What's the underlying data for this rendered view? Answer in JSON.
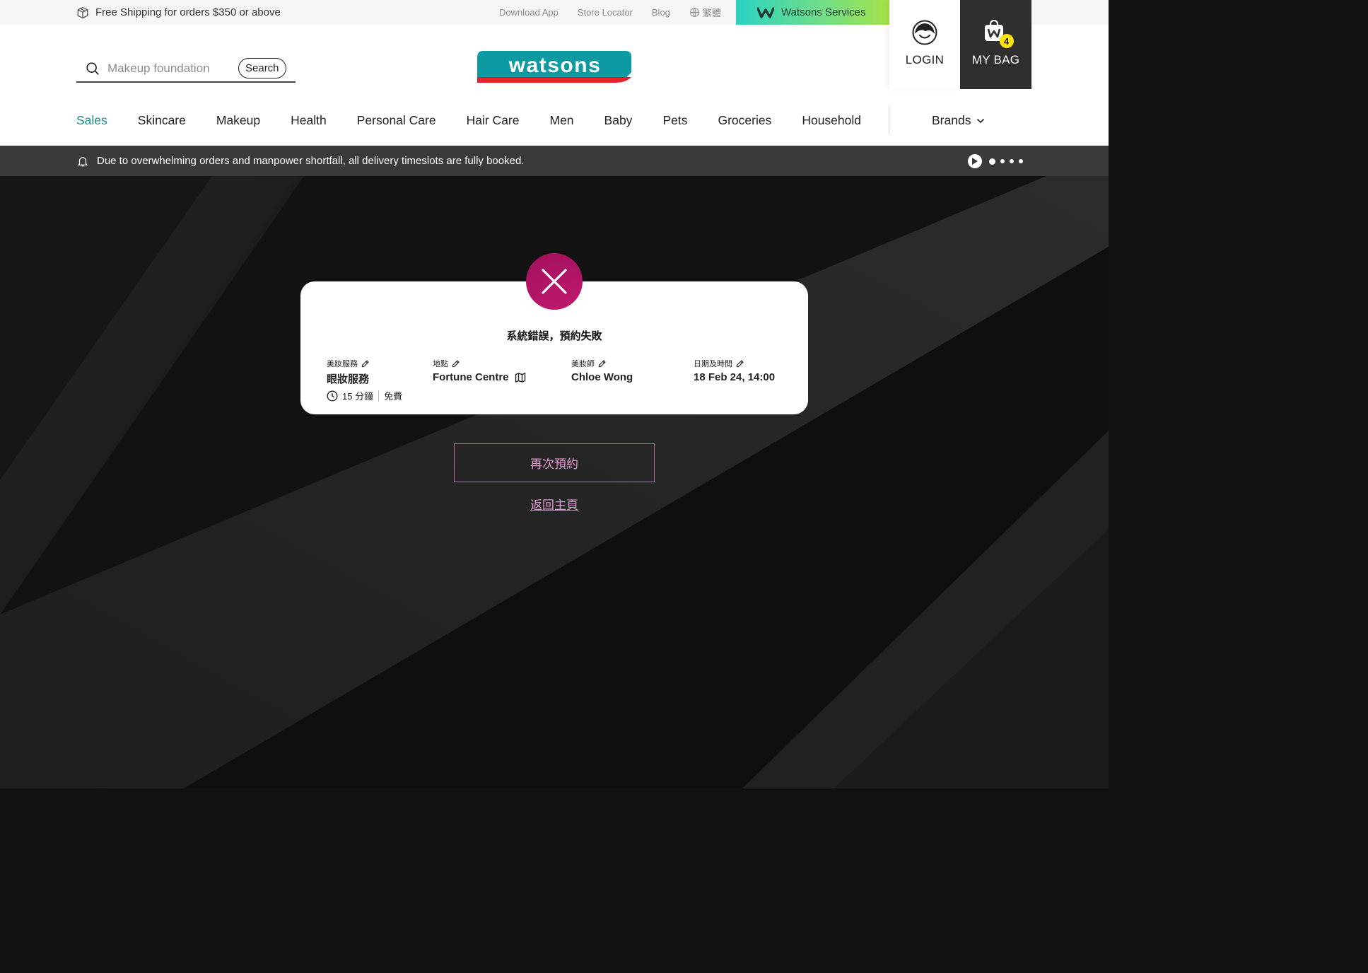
{
  "topbar": {
    "shipping_text": "Free Shipping for orders $350 or above",
    "links": [
      "Download App",
      "Store Locator",
      "Blog"
    ],
    "language": "繁體",
    "services_label": "Watsons Services"
  },
  "header": {
    "search": {
      "placeholder": "Makeup foundation",
      "button_label": "Search"
    },
    "logo_text": "watsons",
    "login_label": "LOGIN",
    "bag_label": "MY BAG",
    "bag_count": "4"
  },
  "nav": {
    "items": [
      "Sales",
      "Skincare",
      "Makeup",
      "Health",
      "Personal Care",
      "Hair Care",
      "Men",
      "Baby",
      "Pets",
      "Groceries",
      "Household"
    ],
    "active": "Sales",
    "brands_label": "Brands"
  },
  "announcement": {
    "text": "Due to overwhelming orders and manpower shortfall, all delivery timeslots are fully booked.",
    "slide_count": 4,
    "active_slide": 1
  },
  "booking": {
    "title": "系統錯誤，預約失敗",
    "service": {
      "label": "美妝服務",
      "value": "眼妝服務",
      "duration": "15 分鐘",
      "price": "免費"
    },
    "location": {
      "label": "地點",
      "value": "Fortune Centre"
    },
    "artist": {
      "label": "美妝師",
      "value": "Chloe Wong"
    },
    "datetime": {
      "label": "日期及時間",
      "value": "18 Feb 24, 14:00"
    }
  },
  "actions": {
    "rebook_label": "再次預約",
    "home_label": "返回主頁"
  },
  "colors": {
    "accent_teal": "#1a8a8d",
    "error_magenta": "#b01466",
    "button_pink": "#e39ad0",
    "bag_badge": "#ffe600"
  }
}
